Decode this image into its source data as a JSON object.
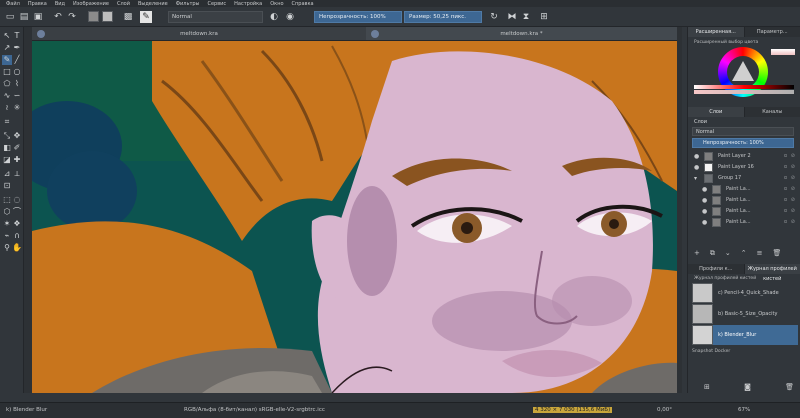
{
  "menu": [
    "Файл",
    "Правка",
    "Вид",
    "Изображение",
    "Слой",
    "Выделение",
    "Фильтры",
    "Сервис",
    "Настройка",
    "Окно",
    "Справка"
  ],
  "toolbar": {
    "blend_mode": "Normal",
    "opacity_label": "Непрозрачность: 100%",
    "size_label": "Размер: 50,25 пикс.",
    "fg_color": "#8b8b8b",
    "bg_color": "#bdbdbd"
  },
  "tabs": [
    {
      "title": "meltdown.kra"
    },
    {
      "title": "meltdown.kra *"
    }
  ],
  "docker": {
    "tabs": [
      "Расширенная...",
      "Параметр..."
    ],
    "color_selector_title": "Расширенный выбор цвета",
    "layers_tabs": [
      "Слои",
      "Каналы"
    ],
    "layers_header": "Слои",
    "layer_blend": "Normal",
    "layer_opacity": "Непрозрачность: 100%",
    "layers": [
      {
        "name": "Paint Layer 2"
      },
      {
        "name": "Paint Layer 16"
      },
      {
        "name": "Group 17"
      },
      {
        "name": "Paint La..."
      },
      {
        "name": "Paint La..."
      },
      {
        "name": "Paint La..."
      },
      {
        "name": "Paint La..."
      }
    ],
    "presets_tabs": [
      "Профили к...",
      "Журнал профилей кистей"
    ],
    "history_title": "Журнал профилей кистей",
    "brushes": [
      {
        "name": "c) Pencil-4_Quick_Shade"
      },
      {
        "name": "b) Basic-5_Size_Opacity"
      },
      {
        "name": "k) Blender_Blur"
      }
    ],
    "snapshot_title": "Snapshot Docker"
  },
  "status": {
    "brush": "k) Blender Blur",
    "color_space": "RGB/Альфа (8-бит/канал)  sRGB-elle-V2-srgbtrc.icc",
    "dimensions": "4 320 × 7 030 (135,6 МиБ)",
    "rotation": "0,00°",
    "zoom": "67%"
  },
  "colors": {
    "accent": "#3d6793",
    "hair": "#c8751d",
    "skin": "#d9b6cf",
    "bg_teal": "#0c5450"
  }
}
